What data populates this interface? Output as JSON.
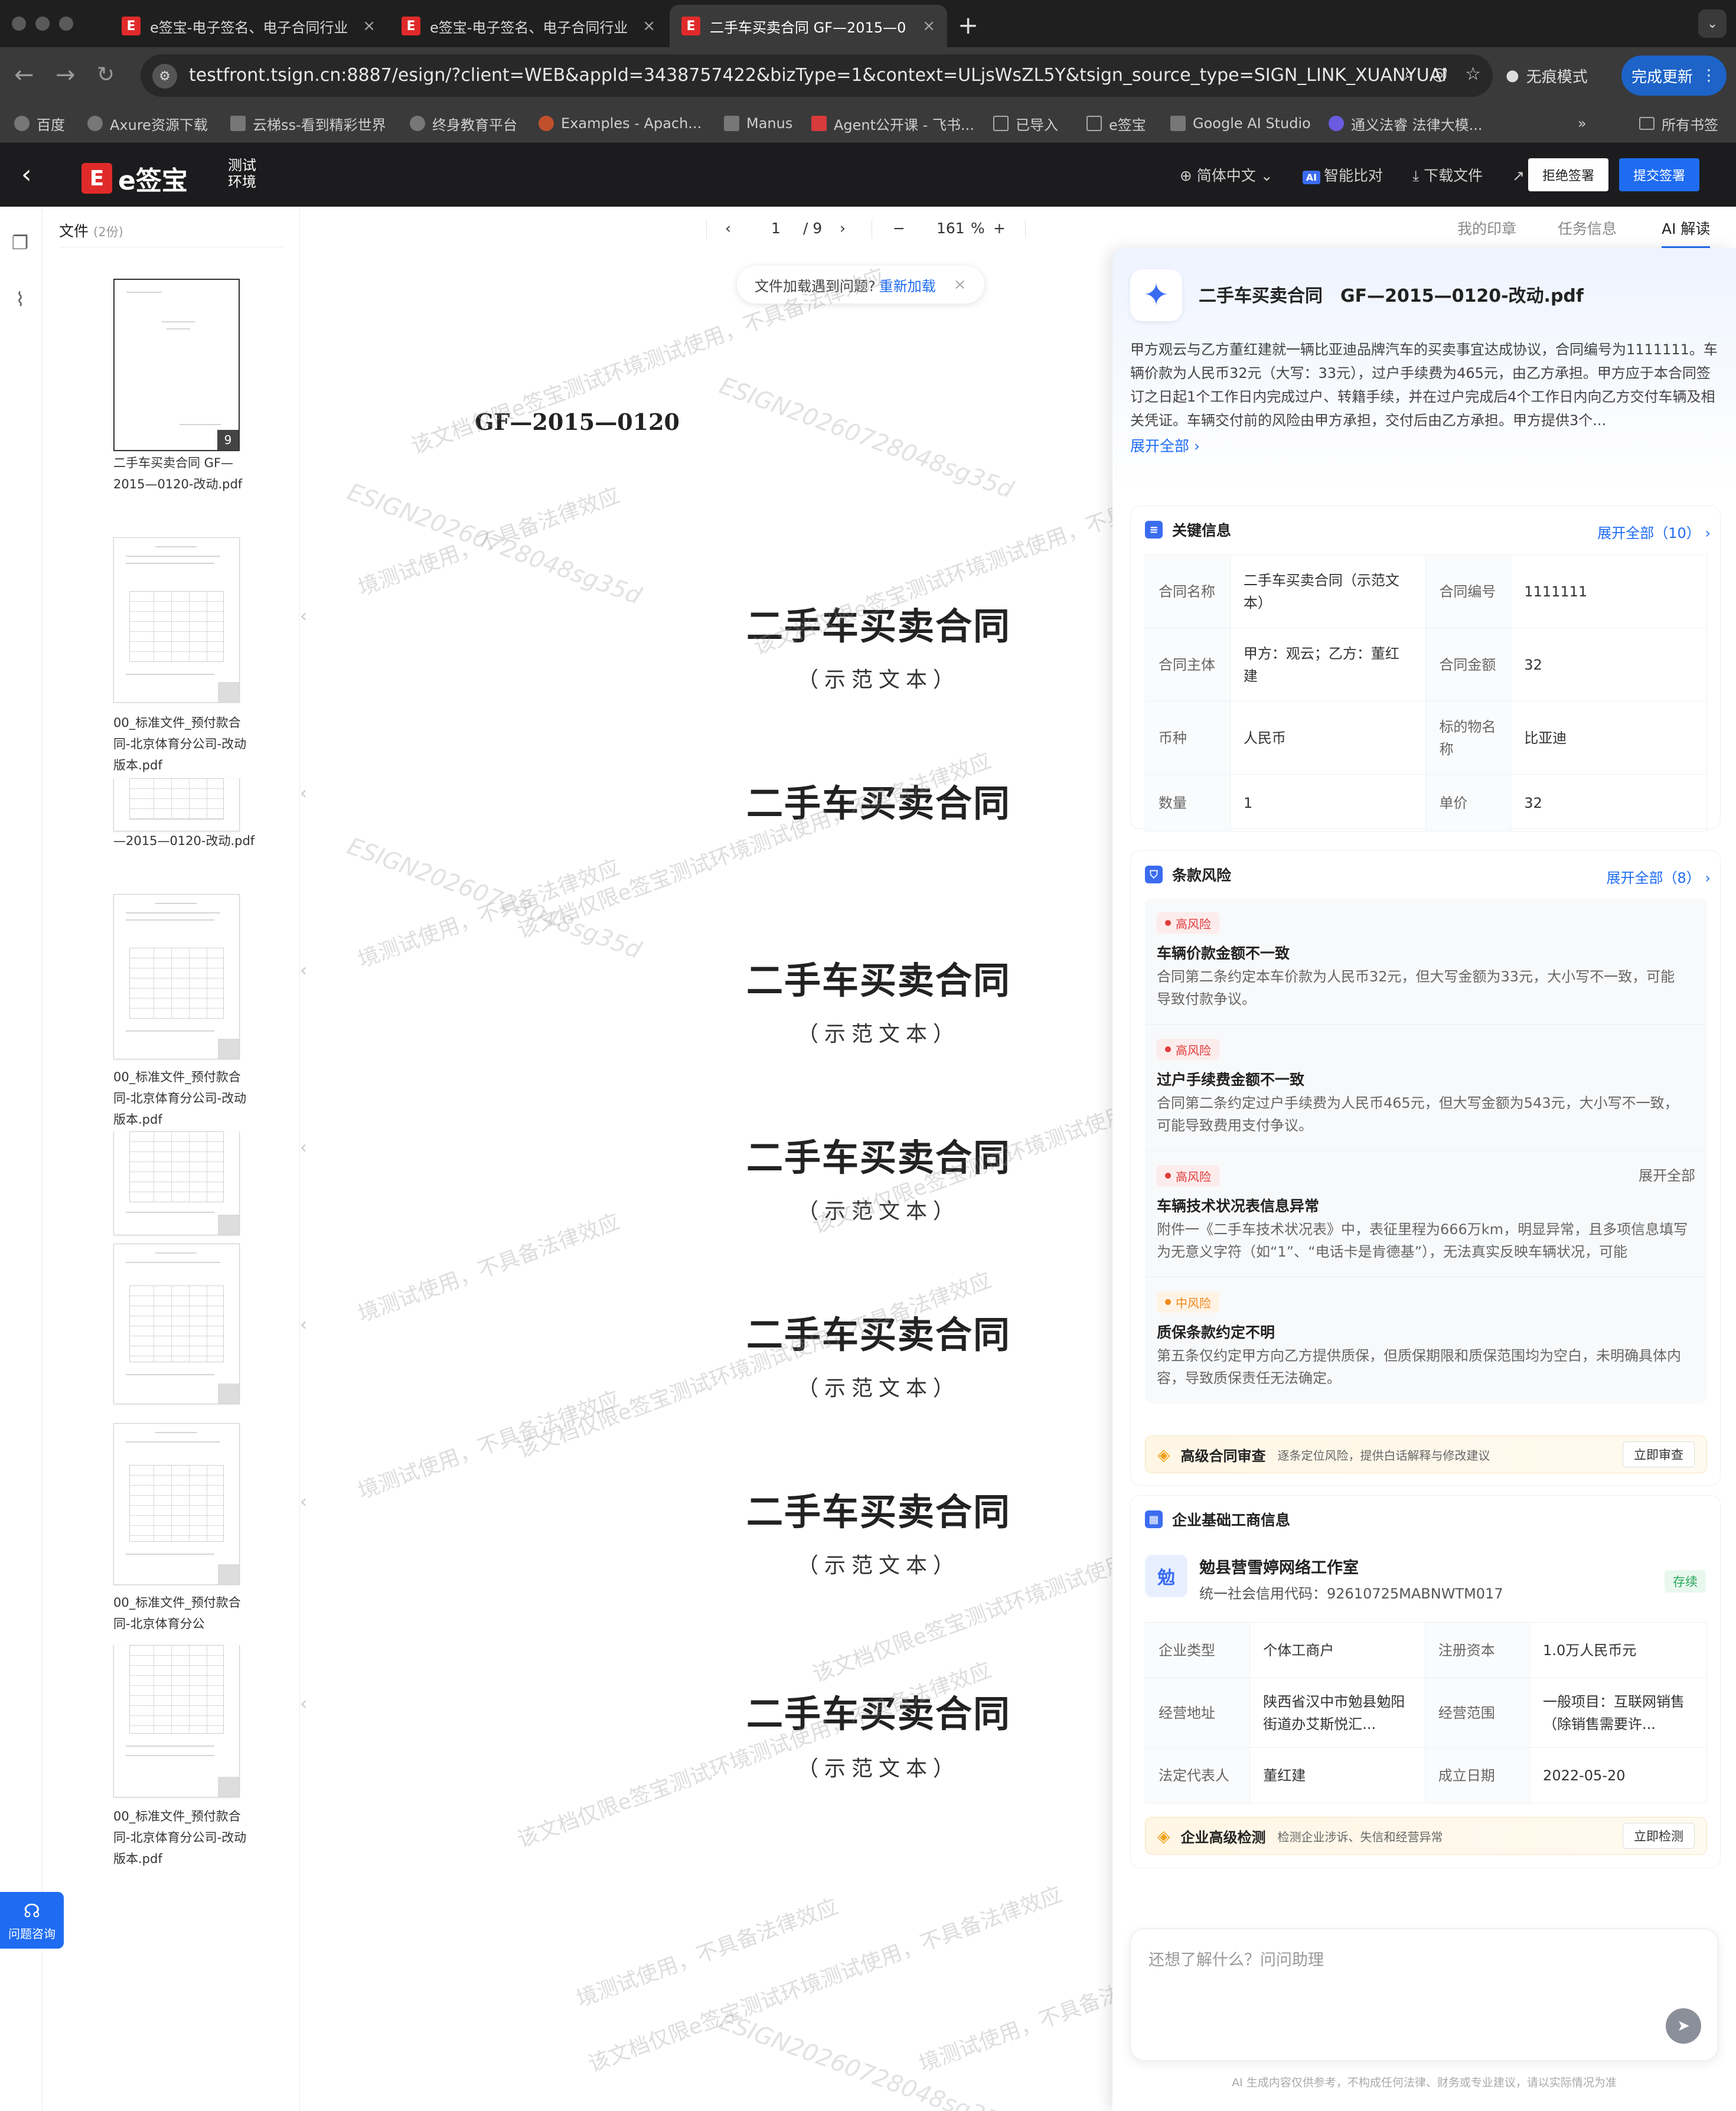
{
  "browser": {
    "tabs": [
      {
        "title": "e签宝-电子签名、电子合同行业",
        "close": "×"
      },
      {
        "title": "e签宝-电子签名、电子合同行业",
        "close": "×"
      },
      {
        "title": "二手车买卖合同 GF—2015—0",
        "close": "×"
      }
    ],
    "favicon_glyph": "E",
    "new_tab": "+",
    "url": "testfront.tsign.cn:8887/esign/?client=WEB&appId=3438757422&bizType=1&context=ULjsWsZL5Y&tsign_source_type=SIGN_LINK_XUANYUAN&tsi...",
    "incognito": "无痕模式",
    "update": "完成更新",
    "bookmarks": [
      "百度",
      "Axure资源下载",
      "云梯ss-看到精彩世界",
      "终身教育平台",
      "Examples - Apach...",
      "Manus",
      "Agent公开课 - 飞书...",
      "已导入",
      "e签宝",
      "Google AI Studio",
      "通义法睿 法律大模..."
    ],
    "bookmarks_more": "»",
    "all_bookmarks": "所有书签"
  },
  "app": {
    "logo_mark": "E",
    "logo_text": "e签宝",
    "env_label": "测试环境",
    "language": "简体中文",
    "ai_chip": "AI",
    "smart_compare": "智能比对",
    "download": "下载文件",
    "forward": "转交",
    "reject": "拒绝签署",
    "submit": "提交签署"
  },
  "files": {
    "header": "文件",
    "count": "(2份)",
    "items": [
      {
        "title": "二手车买卖合同 GF—2015—0120-改动.pdf",
        "page": "9"
      },
      {
        "title": "00_标准文件_预付款合同-北京体育分公司-改动版本.pdf"
      },
      {
        "title": "—2015—0120-改动.pdf"
      },
      {
        "title": "00_标准文件_预付款合同-北京体育分公司-改动版本.pdf"
      },
      {
        "title": "00_标准文件_预付款合同-北京体育分公"
      },
      {
        "title": "00_标准文件_预付款合同-北京体育分公司-改动版本.pdf"
      }
    ]
  },
  "help": {
    "label": "问题咨询"
  },
  "viewer": {
    "page_current": "1",
    "page_total": "/ 9",
    "zoom": "161",
    "zoom_unit": "%",
    "notice_text": "文件加载遇到问题?",
    "notice_link": "重新加载",
    "doc_code": "GF—2015—0120",
    "page_title": "二手车买卖合同",
    "page_subtitle": "（示范文本）",
    "watermark": "该文档仅限e签宝测试环境测试使用，不具备法律效应",
    "watermark_short": "境测试使用，不具备法律效应",
    "watermark_id": "ESIGN20260728048sg35d"
  },
  "right_tabs": [
    "我的印章",
    "任务信息",
    "AI 解读"
  ],
  "ai": {
    "title": "二手车买卖合同　GF—2015—0120-改动.pdf",
    "summary": "甲方观云与乙方董红建就一辆比亚迪品牌汽车的买卖事宜达成协议，合同编号为1111111。车辆价款为人民币32元（大写：33元），过户手续费为465元，由乙方承担。甲方应于本合同签订之日起1个工作日内完成过户、转籍手续，并在过户完成后4个工作日内向乙方交付车辆及相关凭证。车辆交付前的风险由甲方承担，交付后由乙方承担。甲方提供3个...",
    "expand": "展开全部",
    "key_info": {
      "title": "关键信息",
      "more": "展开全部（10）",
      "rows": [
        [
          {
            "k": "合同名称",
            "v": "二手车买卖合同（示范文本）"
          },
          {
            "k": "合同编号",
            "v": "1111111"
          }
        ],
        [
          {
            "k": "合同主体",
            "v": "甲方：观云；乙方：董红建"
          },
          {
            "k": "合同金额",
            "v": "32"
          }
        ],
        [
          {
            "k": "币种",
            "v": "人民币"
          },
          {
            "k": "标的物名称",
            "v": "比亚迪"
          }
        ],
        [
          {
            "k": "数量",
            "v": "1"
          },
          {
            "k": "单价",
            "v": "32"
          }
        ]
      ]
    },
    "risks": {
      "title": "条款风险",
      "more": "展开全部（8）",
      "items": [
        {
          "level": "高风险",
          "title": "车辆价款金额不一致",
          "desc": "合同第二条约定本车价款为人民币32元，但大写金额为33元，大小写不一致，可能导致付款争议。"
        },
        {
          "level": "高风险",
          "title": "过户手续费金额不一致",
          "desc": "合同第二条约定过户手续费为人民币465元，但大写金额为543元，大小写不一致，可能导致费用支付争议。"
        },
        {
          "level": "高风险",
          "title": "车辆技术状况表信息异常",
          "desc": "附件一《二手车技术状况表》中，表征里程为666万km，明显异常，且多项信息填写为无意义字符（如“1”、“电话卡是肯德基”），无法真实反映车辆状况，可能",
          "more": "展开全部"
        },
        {
          "level": "中风险",
          "title": "质保条款约定不明",
          "desc": "第五条仅约定甲方向乙方提供质保，但质保期限和质保范围均为空白，未明确具体内容，导致质保责任无法确定。"
        }
      ],
      "promo_title": "高级合同审查",
      "promo_desc": "逐条定位风险，提供白话解释与修改建议",
      "promo_btn": "立即审查"
    },
    "company": {
      "title": "企业基础工商信息",
      "logo": "勉",
      "name": "勉县营雪婷网络工作室",
      "code": "统一社会信用代码：92610725MABNWTM017",
      "status": "存续",
      "rows": [
        [
          {
            "k": "企业类型",
            "v": "个体工商户"
          },
          {
            "k": "注册资本",
            "v": "1.0万人民币元"
          }
        ],
        [
          {
            "k": "经营地址",
            "v": "陕西省汉中市勉县勉阳街道办艾斯悦汇..."
          },
          {
            "k": "经营范围",
            "v": "一般项目：互联网销售（除销售需要许..."
          }
        ],
        [
          {
            "k": "法定代表人",
            "v": "董红建"
          },
          {
            "k": "成立日期",
            "v": "2022-05-20"
          }
        ]
      ],
      "promo_title": "企业高级检测",
      "promo_desc": "检测企业涉诉、失信和经营异常",
      "promo_btn": "立即检测"
    },
    "chat_placeholder": "还想了解什么？问问助理",
    "disclaimer": "AI 生成内容仅供参考，不构成任何法律、财务或专业建议，请以实际情况为准"
  },
  "colors": {
    "brand_red": "#e02a2a",
    "primary_blue": "#1f6cf2",
    "risk_high": "#e03b3b",
    "risk_mid": "#f08a1c",
    "status_green": "#2aa85b"
  }
}
